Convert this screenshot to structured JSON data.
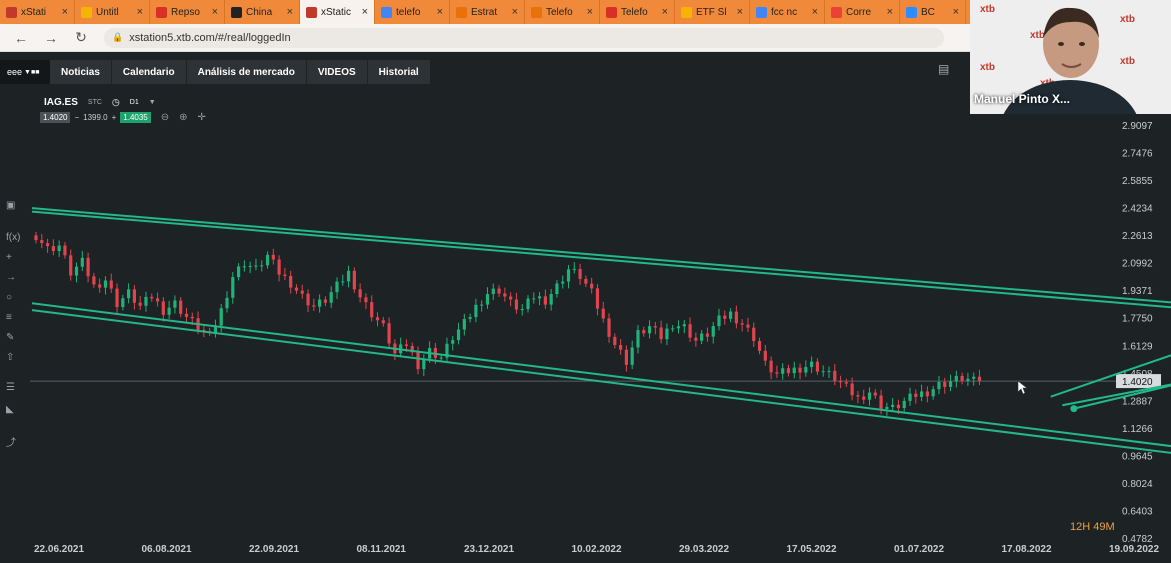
{
  "browser": {
    "tabs": [
      {
        "label": "xStati",
        "fav": "#c0392b"
      },
      {
        "label": "Untitl",
        "fav": "#f4b400"
      },
      {
        "label": "Repso",
        "fav": "#d93025"
      },
      {
        "label": "China",
        "fav": "#222222"
      },
      {
        "label": "xStatic",
        "fav": "#c0392b",
        "active": true
      },
      {
        "label": "telefo",
        "fav": "#4285f4"
      },
      {
        "label": "Estrat",
        "fav": "#e8710a"
      },
      {
        "label": "Telefo",
        "fav": "#e8710a"
      },
      {
        "label": "Telefo",
        "fav": "#d93025"
      },
      {
        "label": "ETF Sl",
        "fav": "#f4b400"
      },
      {
        "label": "fcc nc",
        "fav": "#4285f4"
      },
      {
        "label": "Corre",
        "fav": "#ea4335"
      },
      {
        "label": "BC",
        "fav": "#2d8cff"
      }
    ],
    "url": "xstation5.xtb.com/#/real/loggedIn"
  },
  "app": {
    "menu_icon_label": "eee",
    "menu": [
      "Noticias",
      "Calendario",
      "Análisis de mercado",
      "VIDEOS",
      "Historial"
    ]
  },
  "symbol": {
    "name": "IAG.ES",
    "sub": "STC",
    "interval": "D1",
    "bid": "1.4020",
    "spread": "1399.0",
    "ask": "1.4035"
  },
  "chart_data": {
    "type": "candlestick",
    "x_ticks": [
      "22.06.2021",
      "06.08.2021",
      "22.09.2021",
      "08.11.2021",
      "23.12.2021",
      "10.02.2022",
      "29.03.2022",
      "17.05.2022",
      "01.07.2022",
      "17.08.2022",
      "19.09.2022"
    ],
    "y_ticks": [
      "2.9097",
      "2.7476",
      "2.5855",
      "2.4234",
      "2.2613",
      "2.0992",
      "1.9371",
      "1.7750",
      "1.6129",
      "1.4508",
      "1.2887",
      "1.1266",
      "0.9645",
      "0.8024",
      "0.6403",
      "0.4782"
    ],
    "current_price": "1.4020",
    "ylim": [
      0.4782,
      2.9097
    ],
    "colors": {
      "up": "#1fb37a",
      "down": "#e0454f",
      "channel": "#22b88a"
    },
    "path": [
      [
        0,
        2.26
      ],
      [
        2,
        2.18
      ],
      [
        4,
        2.2
      ],
      [
        6,
        2.04
      ],
      [
        8,
        2.1
      ],
      [
        10,
        1.96
      ],
      [
        12,
        2.0
      ],
      [
        14,
        1.86
      ],
      [
        16,
        1.92
      ],
      [
        18,
        1.84
      ],
      [
        20,
        1.9
      ],
      [
        22,
        1.82
      ],
      [
        24,
        1.86
      ],
      [
        26,
        1.78
      ],
      [
        28,
        1.72
      ],
      [
        30,
        1.66
      ],
      [
        32,
        1.82
      ],
      [
        34,
        2.02
      ],
      [
        36,
        2.1
      ],
      [
        38,
        2.06
      ],
      [
        40,
        2.14
      ],
      [
        42,
        2.04
      ],
      [
        44,
        1.98
      ],
      [
        46,
        1.9
      ],
      [
        48,
        1.84
      ],
      [
        50,
        1.88
      ],
      [
        52,
        1.96
      ],
      [
        54,
        2.04
      ],
      [
        56,
        1.9
      ],
      [
        58,
        1.8
      ],
      [
        60,
        1.72
      ],
      [
        62,
        1.56
      ],
      [
        64,
        1.62
      ],
      [
        66,
        1.5
      ],
      [
        68,
        1.58
      ],
      [
        70,
        1.54
      ],
      [
        72,
        1.66
      ],
      [
        74,
        1.74
      ],
      [
        76,
        1.84
      ],
      [
        78,
        1.92
      ],
      [
        80,
        1.94
      ],
      [
        82,
        1.86
      ],
      [
        84,
        1.82
      ],
      [
        86,
        1.9
      ],
      [
        88,
        1.88
      ],
      [
        90,
        1.96
      ],
      [
        92,
        2.06
      ],
      [
        94,
        2.02
      ],
      [
        96,
        1.92
      ],
      [
        98,
        1.76
      ],
      [
        100,
        1.62
      ],
      [
        102,
        1.52
      ],
      [
        104,
        1.68
      ],
      [
        106,
        1.72
      ],
      [
        108,
        1.66
      ],
      [
        110,
        1.74
      ],
      [
        112,
        1.72
      ],
      [
        114,
        1.64
      ],
      [
        116,
        1.68
      ],
      [
        118,
        1.76
      ],
      [
        120,
        1.8
      ],
      [
        122,
        1.74
      ],
      [
        124,
        1.66
      ],
      [
        126,
        1.5
      ],
      [
        128,
        1.44
      ],
      [
        130,
        1.46
      ],
      [
        132,
        1.48
      ],
      [
        134,
        1.5
      ],
      [
        136,
        1.46
      ],
      [
        138,
        1.42
      ],
      [
        140,
        1.36
      ],
      [
        142,
        1.3
      ],
      [
        144,
        1.34
      ],
      [
        146,
        1.26
      ],
      [
        148,
        1.24
      ],
      [
        150,
        1.28
      ],
      [
        152,
        1.32
      ],
      [
        154,
        1.34
      ],
      [
        156,
        1.38
      ],
      [
        158,
        1.4
      ],
      [
        160,
        1.42
      ],
      [
        162,
        1.4
      ],
      [
        164,
        1.43
      ]
    ],
    "channels": [
      [
        [
          0,
          2.42
        ],
        [
          230,
          1.77
        ]
      ],
      [
        [
          0,
          2.4
        ],
        [
          230,
          1.74
        ]
      ],
      [
        [
          0,
          1.86
        ],
        [
          210,
          0.96
        ]
      ],
      [
        [
          0,
          1.82
        ],
        [
          210,
          0.92
        ]
      ],
      [
        [
          176,
          1.31
        ],
        [
          200,
          1.6
        ]
      ],
      [
        [
          178,
          1.26
        ],
        [
          202,
          1.42
        ]
      ],
      [
        [
          180,
          1.24
        ],
        [
          204,
          1.44
        ]
      ]
    ]
  },
  "overlay": {
    "presenter": "Manuel Pinto X...",
    "watermark": "xtb",
    "timer": "12H 49M"
  }
}
